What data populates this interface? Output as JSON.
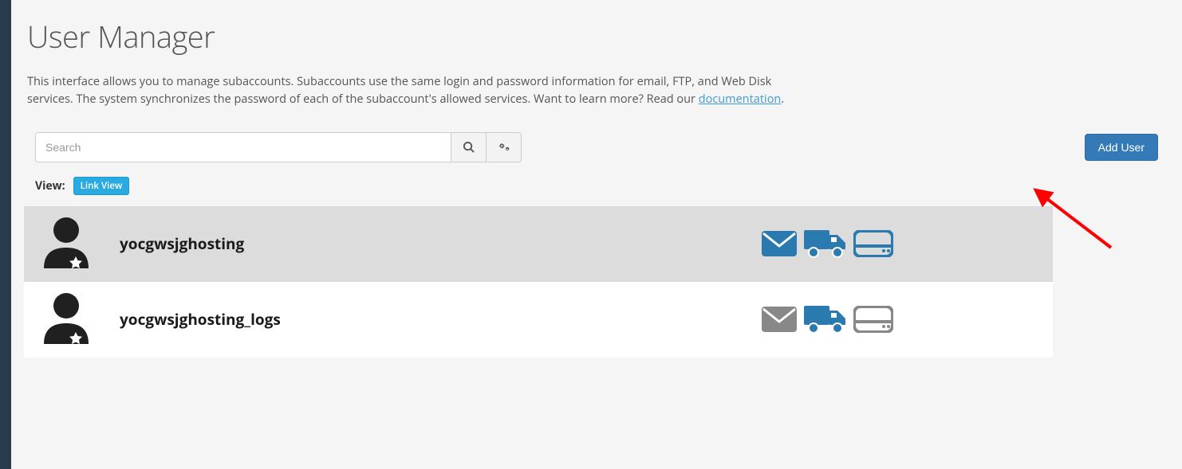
{
  "page": {
    "title": "User Manager",
    "description_part1": "This interface allows you to manage subaccounts. Subaccounts use the same login and password information for email, FTP, and Web Disk services. The system synchronizes the password of each of the subaccount's allowed services. Want to learn more? Read our ",
    "doc_link_text": "documentation",
    "description_part2": "."
  },
  "toolbar": {
    "search_placeholder": "Search",
    "add_user_label": "Add User"
  },
  "view": {
    "label": "View:",
    "badge": "Link View"
  },
  "users": [
    {
      "name": "yocgwsjghosting",
      "selected": true,
      "services": {
        "email": true,
        "ftp": true,
        "disk": true
      }
    },
    {
      "name": "yocgwsjghosting_logs",
      "selected": false,
      "services": {
        "email": false,
        "ftp": true,
        "disk": false
      }
    }
  ],
  "colors": {
    "enabled": "#2a7ab0",
    "disabled": "#888888"
  }
}
